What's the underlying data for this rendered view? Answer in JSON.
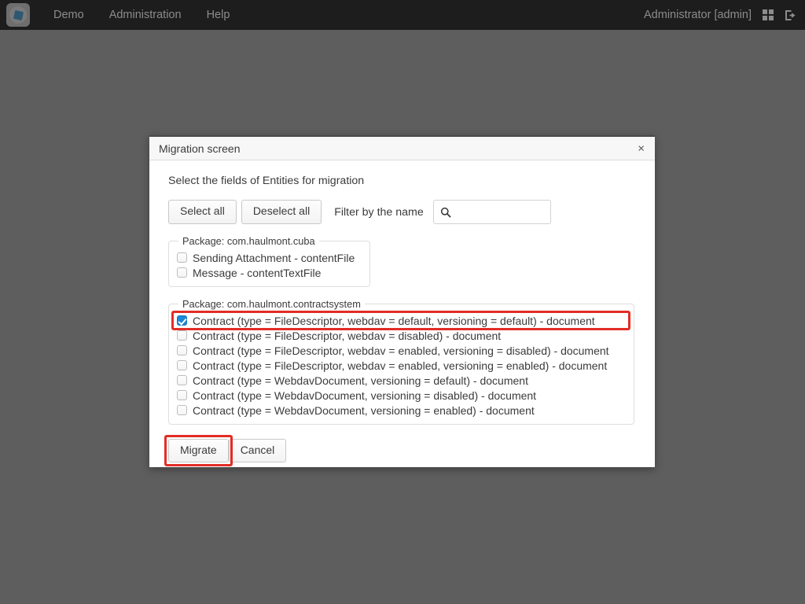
{
  "topbar": {
    "logo_icon": "app-logo-icon",
    "menu": [
      {
        "label": "Demo"
      },
      {
        "label": "Administration"
      },
      {
        "label": "Help"
      }
    ],
    "user_label": "Administrator [admin]",
    "apps_icon": "grid-apps-icon",
    "logout_icon": "logout-icon"
  },
  "dialog": {
    "title": "Migration screen",
    "close_label": "×",
    "subtitle": "Select the fields of Entities for migration",
    "toolbar": {
      "select_all_label": "Select all",
      "deselect_all_label": "Deselect all",
      "filter_label": "Filter by the name",
      "search_value": "",
      "search_placeholder": "",
      "search_icon": "search-icon"
    },
    "groups": [
      {
        "legend": "Package: com.haulmont.cuba",
        "items": [
          {
            "label": "Sending Attachment - contentFile",
            "checked": false,
            "highlighted": false
          },
          {
            "label": "Message - contentTextFile",
            "checked": false,
            "highlighted": false
          }
        ]
      },
      {
        "legend": "Package: com.haulmont.contractsystem",
        "items": [
          {
            "label": "Contract (type = FileDescriptor, webdav = default, versioning = default) - document",
            "checked": true,
            "highlighted": true
          },
          {
            "label": "Contract (type = FileDescriptor, webdav = disabled) - document",
            "checked": false,
            "highlighted": false
          },
          {
            "label": "Contract (type = FileDescriptor, webdav = enabled, versioning = disabled) - document",
            "checked": false,
            "highlighted": false
          },
          {
            "label": "Contract (type = FileDescriptor, webdav = enabled, versioning = enabled) - document",
            "checked": false,
            "highlighted": false
          },
          {
            "label": "Contract (type = WebdavDocument, versioning = default) - document",
            "checked": false,
            "highlighted": false
          },
          {
            "label": "Contract (type = WebdavDocument, versioning = disabled) - document",
            "checked": false,
            "highlighted": false
          },
          {
            "label": "Contract (type = WebdavDocument, versioning = enabled) - document",
            "checked": false,
            "highlighted": false
          }
        ]
      }
    ],
    "footer": {
      "migrate_label": "Migrate",
      "cancel_label": "Cancel"
    }
  },
  "colors": {
    "page_background": "#5e5e5e",
    "topbar_background": "#1d1d1d",
    "topbar_text": "#8c8c8c",
    "dialog_background": "#ffffff",
    "highlight_red": "#e22d26",
    "checkbox_blue": "#1e87d6",
    "text": "#3b3b3b"
  }
}
